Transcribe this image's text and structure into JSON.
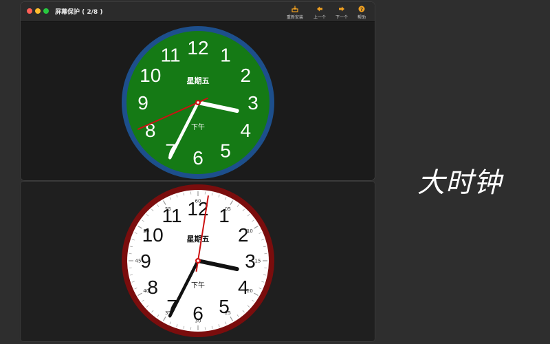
{
  "window": {
    "title": "屏幕保护 ( 2/8 )"
  },
  "toolbar": {
    "reinstall_label": "重新安装",
    "prev_label": "上一个",
    "next_label": "下一个",
    "help_label": "帮助"
  },
  "clock_top": {
    "weekday": "星期五",
    "ampm": "下午",
    "numbers": [
      "12",
      "1",
      "2",
      "3",
      "4",
      "5",
      "6",
      "7",
      "8",
      "9",
      "10",
      "11"
    ],
    "hour": 3.4,
    "minute": 34.5,
    "second": 41,
    "colors": {
      "rim": "#1d4f8c",
      "face": "#157a15",
      "text": "#ffffff",
      "hands": "#ffffff",
      "second_hand": "#cc1111"
    }
  },
  "clock_bottom": {
    "weekday": "星期五",
    "ampm": "下午",
    "numbers": [
      "12",
      "1",
      "2",
      "3",
      "4",
      "5",
      "6",
      "7",
      "8",
      "9",
      "10",
      "11"
    ],
    "minute_labels": [
      "60",
      "05",
      "10",
      "15",
      "20",
      "25",
      "30",
      "35",
      "40",
      "45",
      "50",
      "55"
    ],
    "hour": 3.4,
    "minute": 34.5,
    "second": 1.5,
    "colors": {
      "rim": "#7a0d0d",
      "face": "#ffffff",
      "text": "#111111",
      "hands": "#111111",
      "second_hand": "#cc1111"
    }
  },
  "caption": "大时钟"
}
